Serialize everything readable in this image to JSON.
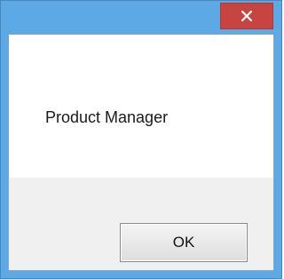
{
  "dialog": {
    "close_icon": "close-icon",
    "message": "Product Manager",
    "ok_label": "OK"
  },
  "colors": {
    "frame": "#5da9e6",
    "close_button": "#c84440",
    "client_background": "#ffffff",
    "footer_background": "#f0f0f0"
  }
}
